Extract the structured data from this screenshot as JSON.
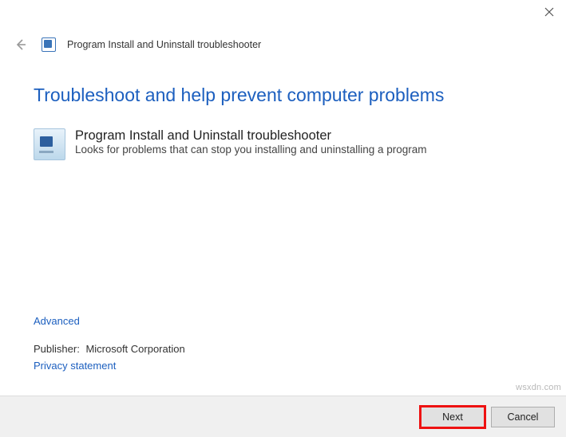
{
  "window": {
    "title": "Program Install and Uninstall troubleshooter"
  },
  "heading": "Troubleshoot and help prevent computer problems",
  "troubleshooter": {
    "title": "Program Install and Uninstall troubleshooter",
    "description": "Looks for problems that can stop you installing and uninstalling a program"
  },
  "advanced_link": "Advanced",
  "publisher": {
    "label": "Publisher:",
    "value": "Microsoft Corporation"
  },
  "privacy_link": "Privacy statement",
  "buttons": {
    "next": "Next",
    "cancel": "Cancel"
  },
  "watermark": "wsxdn.com"
}
